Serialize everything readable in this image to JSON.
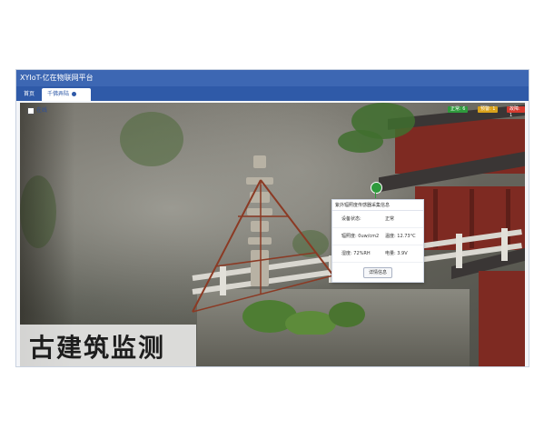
{
  "app": {
    "title": "XYIoT-亿在物联网平台"
  },
  "tabs": [
    {
      "label": "首页"
    },
    {
      "label": "千佛弄陆"
    }
  ],
  "map": {
    "checkbox_label": "在线",
    "legend": {
      "normal": "正常: 6",
      "warn": "预警: 1",
      "fault": "故障: 1"
    }
  },
  "popup": {
    "title": "紫外辐照度传感器采集信息",
    "rows": [
      {
        "c1": "设备状态:",
        "c2": "正常"
      },
      {
        "c1": "辐照度: 0uw/cm2",
        "c2": "温度: 12.73°C"
      },
      {
        "c1": "湿度: 72%RH",
        "c2": "电量: 3.9V"
      }
    ],
    "detail_button": "详情信息"
  },
  "caption": "古建筑监测",
  "colors": {
    "header": "#3d67b3",
    "tab_bar": "#2f5aa8",
    "normal": "#2e9a3c",
    "warn": "#d9a21b",
    "fault": "#d43a2f"
  }
}
